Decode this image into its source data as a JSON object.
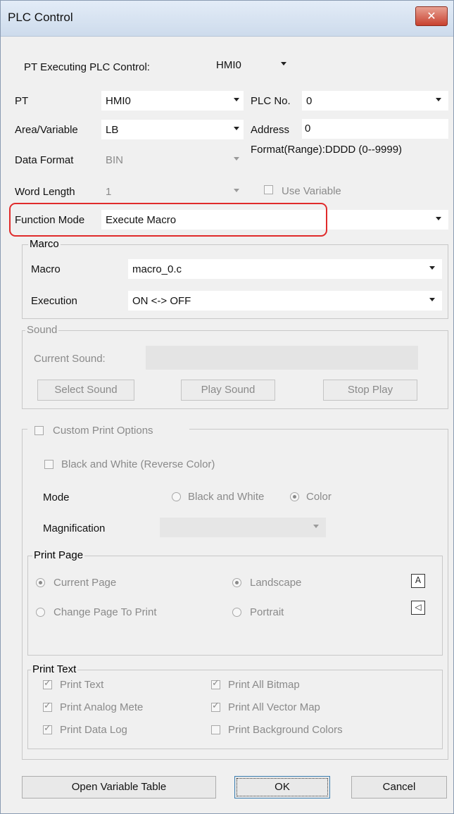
{
  "window": {
    "title": "PLC Control",
    "close_glyph": "✕"
  },
  "pt_exec": {
    "label": "PT Executing PLC Control:",
    "value": "HMI0"
  },
  "pt": {
    "label": "PT",
    "value": "HMI0"
  },
  "plc_no": {
    "label": "PLC No.",
    "value": "0"
  },
  "area": {
    "label": "Area/Variable",
    "value": "LB"
  },
  "address": {
    "label": "Address",
    "value": "0"
  },
  "data_format": {
    "label": "Data Format",
    "value": "BIN",
    "range_text": "Format(Range):DDDD (0--9999)"
  },
  "word_length": {
    "label": "Word Length",
    "value": "1",
    "use_variable": "Use Variable"
  },
  "function_mode": {
    "label": "Function Mode",
    "value": "Execute Macro"
  },
  "macro_group": {
    "title": "Marco",
    "macro_label": "Macro",
    "macro_value": "macro_0.c",
    "execution_label": "Execution",
    "execution_value": "ON <-> OFF"
  },
  "sound_group": {
    "title": "Sound",
    "current_sound": "Current Sound:",
    "select": "Select Sound",
    "play": "Play Sound",
    "stop": "Stop Play"
  },
  "print_options": {
    "title": "Custom Print Options",
    "bw_reverse": "Black and White (Reverse Color)",
    "mode_label": "Mode",
    "mode_bw": "Black and White",
    "mode_color": "Color",
    "magnification": "Magnification"
  },
  "print_page": {
    "title": "Print Page",
    "current_page": "Current Page",
    "change_page": "Change Page To Print",
    "landscape": "Landscape",
    "portrait": "Portrait",
    "landscape_icon": "A",
    "portrait_icon": "◁"
  },
  "print_text": {
    "title": "Print Text",
    "items": [
      "Print Text",
      "Print All Bitmap",
      "Print Analog Mete",
      "Print All Vector Map",
      "Print Data Log",
      "Print Background Colors"
    ]
  },
  "footer": {
    "open_table": "Open Variable Table",
    "ok": "OK",
    "cancel": "Cancel"
  },
  "colors": {
    "highlight": "#e02b2b",
    "close": "#c8412f"
  }
}
